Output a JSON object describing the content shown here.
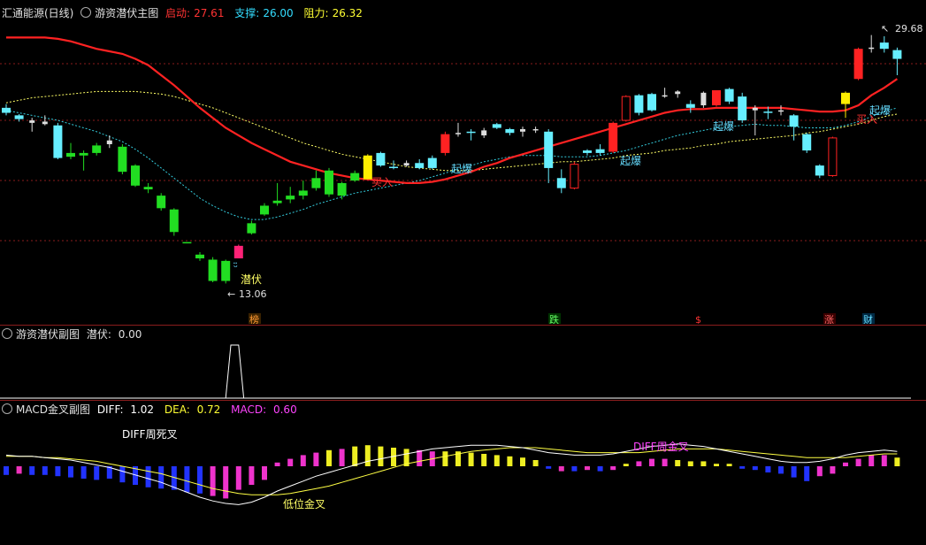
{
  "main_panel": {
    "title": "汇通能源(日线)",
    "indicator_name": "游资潜伏主图",
    "readouts": [
      {
        "label": "启动:",
        "value": "27.61",
        "color": "#ff3333"
      },
      {
        "label": "支撑:",
        "value": "26.00",
        "color": "#33ddff"
      },
      {
        "label": "阻力:",
        "value": "26.32",
        "color": "#ffff33"
      }
    ],
    "high_label": "29.68",
    "low_label": "13.06",
    "annotations": [
      {
        "text": "潜伏",
        "color": "#ffff66"
      },
      {
        "text": "买入",
        "color": "#ff3333"
      },
      {
        "text": "起爆",
        "color": "#66ddff"
      },
      {
        "text": "起爆",
        "color": "#66ddff"
      },
      {
        "text": "起爆",
        "color": "#66ddff"
      },
      {
        "text": "买入",
        "color": "#ff3333"
      },
      {
        "text": "起爆",
        "color": "#66ddff"
      }
    ],
    "markers": [
      {
        "text": "榜",
        "color": "#ff9933"
      },
      {
        "text": "跌",
        "color": "#66ff66"
      },
      {
        "text": "$",
        "color": "#ff3333"
      },
      {
        "text": "涨",
        "color": "#ff6666"
      },
      {
        "text": "财",
        "color": "#66ddff"
      }
    ]
  },
  "sub_panel": {
    "indicator_name": "游资潜伏副图",
    "readout_label": "潜伏:",
    "readout_value": "0.00"
  },
  "macd_panel": {
    "indicator_name": "MACD金叉副图",
    "diff_label": "DIFF:",
    "diff_value": "1.02",
    "dea_label": "DEA:",
    "dea_value": "0.72",
    "macd_label": "MACD:",
    "macd_value": "0.60",
    "annotations": [
      {
        "text": "DIFF周死叉",
        "color": "#ffffff"
      },
      {
        "text": "低位金叉",
        "color": "#ffff66"
      },
      {
        "text": "DIFF周金叉",
        "color": "#ff44ff"
      }
    ]
  },
  "colors": {
    "up": "#66eeff",
    "down": "#22dd22",
    "red_candle": "#ff2222",
    "ma_red": "#ff2222",
    "ma_yellow": "#ffff66",
    "ma_cyan": "#33ccdd",
    "grid": "#8a1d1d"
  },
  "chart_data": {
    "type": "candlestick",
    "candles": [
      {
        "o": 24.2,
        "c": 24.6,
        "h": 24.9,
        "l": 24.0,
        "color": "cyan"
      },
      {
        "o": 24.0,
        "c": 23.7,
        "h": 24.1,
        "l": 23.5,
        "color": "cyan"
      },
      {
        "o": 23.6,
        "c": 23.4,
        "h": 23.8,
        "l": 22.7,
        "color": "white"
      },
      {
        "o": 23.5,
        "c": 23.3,
        "h": 24.0,
        "l": 23.2,
        "color": "white"
      },
      {
        "o": 23.2,
        "c": 20.6,
        "h": 23.4,
        "l": 20.5,
        "color": "cyan"
      },
      {
        "o": 21.0,
        "c": 20.7,
        "h": 21.8,
        "l": 20.5,
        "color": "green"
      },
      {
        "o": 21.0,
        "c": 20.8,
        "h": 21.2,
        "l": 19.6,
        "color": "green"
      },
      {
        "o": 21.0,
        "c": 21.6,
        "h": 21.8,
        "l": 20.8,
        "color": "green"
      },
      {
        "o": 22.0,
        "c": 21.7,
        "h": 22.4,
        "l": 21.4,
        "color": "white"
      },
      {
        "o": 21.5,
        "c": 19.5,
        "h": 21.7,
        "l": 19.3,
        "color": "green"
      },
      {
        "o": 20.0,
        "c": 18.4,
        "h": 20.1,
        "l": 18.3,
        "color": "green"
      },
      {
        "o": 18.3,
        "c": 18.1,
        "h": 18.6,
        "l": 17.8,
        "color": "green"
      },
      {
        "o": 17.6,
        "c": 16.6,
        "h": 17.8,
        "l": 16.4,
        "color": "green"
      },
      {
        "o": 16.5,
        "c": 14.7,
        "h": 16.6,
        "l": 14.4,
        "color": "green"
      },
      {
        "o": 13.9,
        "c": 13.9,
        "h": 13.9,
        "l": 13.9,
        "color": "green"
      },
      {
        "o": 12.9,
        "c": 12.6,
        "h": 13.1,
        "l": 12.4,
        "color": "green"
      },
      {
        "o": 12.5,
        "c": 10.8,
        "h": 12.7,
        "l": 10.7,
        "color": "green"
      },
      {
        "o": 12.4,
        "c": 10.8,
        "h": 12.5,
        "l": 10.6,
        "color": "green"
      },
      {
        "o": 12.6,
        "c": 13.6,
        "h": 13.7,
        "l": 12.6,
        "color": "pink"
      },
      {
        "o": 14.6,
        "c": 15.4,
        "h": 15.6,
        "l": 14.5,
        "color": "green"
      },
      {
        "o": 16.1,
        "c": 16.8,
        "h": 17.0,
        "l": 16.0,
        "color": "green"
      },
      {
        "o": 17.0,
        "c": 17.2,
        "h": 18.6,
        "l": 16.8,
        "color": "green"
      },
      {
        "o": 17.3,
        "c": 17.6,
        "h": 18.3,
        "l": 17.0,
        "color": "green"
      },
      {
        "o": 17.6,
        "c": 18.0,
        "h": 18.8,
        "l": 17.3,
        "color": "green"
      },
      {
        "o": 18.2,
        "c": 19.0,
        "h": 19.6,
        "l": 18.0,
        "color": "green"
      },
      {
        "o": 19.6,
        "c": 17.7,
        "h": 19.8,
        "l": 17.5,
        "color": "green"
      },
      {
        "o": 17.6,
        "c": 18.6,
        "h": 18.7,
        "l": 17.3,
        "color": "green"
      },
      {
        "o": 18.8,
        "c": 19.4,
        "h": 19.6,
        "l": 18.7,
        "color": "green"
      },
      {
        "o": 18.9,
        "c": 20.8,
        "h": 20.9,
        "l": 18.9,
        "color": "yellow"
      },
      {
        "o": 21.0,
        "c": 20.0,
        "h": 21.1,
        "l": 19.9,
        "color": "cyan"
      },
      {
        "o": 19.9,
        "c": 19.9,
        "h": 20.4,
        "l": 19.7,
        "color": "cyan"
      },
      {
        "o": 20.0,
        "c": 20.2,
        "h": 20.4,
        "l": 19.9,
        "color": "white"
      },
      {
        "o": 20.2,
        "c": 19.8,
        "h": 20.5,
        "l": 19.7,
        "color": "cyan"
      },
      {
        "o": 19.8,
        "c": 20.6,
        "h": 20.8,
        "l": 19.7,
        "color": "cyan"
      },
      {
        "o": 21.0,
        "c": 22.5,
        "h": 22.7,
        "l": 20.8,
        "color": "red"
      },
      {
        "o": 22.6,
        "c": 22.6,
        "h": 23.4,
        "l": 22.3,
        "color": "white"
      },
      {
        "o": 22.6,
        "c": 22.7,
        "h": 22.9,
        "l": 22.0,
        "color": "cyan"
      },
      {
        "o": 22.8,
        "c": 22.4,
        "h": 23.0,
        "l": 22.2,
        "color": "white"
      },
      {
        "o": 23.0,
        "c": 23.3,
        "h": 23.4,
        "l": 22.9,
        "color": "cyan"
      },
      {
        "o": 22.9,
        "c": 22.6,
        "h": 23.0,
        "l": 22.4,
        "color": "cyan"
      },
      {
        "o": 22.7,
        "c": 22.9,
        "h": 23.1,
        "l": 22.3,
        "color": "white"
      },
      {
        "o": 22.9,
        "c": 22.8,
        "h": 23.1,
        "l": 22.6,
        "color": "white"
      },
      {
        "o": 22.7,
        "c": 19.8,
        "h": 22.9,
        "l": 18.6,
        "color": "cyan"
      },
      {
        "o": 19.0,
        "c": 18.2,
        "h": 19.7,
        "l": 17.8,
        "color": "cyan"
      },
      {
        "o": 18.2,
        "c": 20.1,
        "h": 20.3,
        "l": 18.1,
        "color": "hollow"
      },
      {
        "o": 21.2,
        "c": 21.0,
        "h": 21.3,
        "l": 20.8,
        "color": "cyan"
      },
      {
        "o": 21.3,
        "c": 21.0,
        "h": 21.7,
        "l": 20.8,
        "color": "cyan"
      },
      {
        "o": 21.1,
        "c": 23.4,
        "h": 23.5,
        "l": 21.0,
        "color": "red"
      },
      {
        "o": 23.6,
        "c": 25.5,
        "h": 25.6,
        "l": 23.5,
        "color": "hollow"
      },
      {
        "o": 25.6,
        "c": 24.2,
        "h": 25.7,
        "l": 24.0,
        "color": "cyan"
      },
      {
        "o": 24.4,
        "c": 25.7,
        "h": 25.8,
        "l": 24.3,
        "color": "cyan"
      },
      {
        "o": 25.6,
        "c": 25.6,
        "h": 26.2,
        "l": 25.4,
        "color": "white"
      },
      {
        "o": 25.7,
        "c": 25.9,
        "h": 26.0,
        "l": 25.4,
        "color": "white"
      },
      {
        "o": 24.9,
        "c": 24.6,
        "h": 25.2,
        "l": 24.2,
        "color": "cyan"
      },
      {
        "o": 24.8,
        "c": 25.8,
        "h": 25.9,
        "l": 24.6,
        "color": "white"
      },
      {
        "o": 24.8,
        "c": 26.0,
        "h": 26.0,
        "l": 24.7,
        "color": "red"
      },
      {
        "o": 26.1,
        "c": 25.1,
        "h": 26.2,
        "l": 24.9,
        "color": "cyan"
      },
      {
        "o": 25.5,
        "c": 23.6,
        "h": 25.8,
        "l": 23.4,
        "color": "cyan"
      },
      {
        "o": 24.4,
        "c": 24.6,
        "h": 24.8,
        "l": 22.4,
        "color": "white"
      },
      {
        "o": 24.2,
        "c": 24.3,
        "h": 24.7,
        "l": 23.7,
        "color": "cyan"
      },
      {
        "o": 24.4,
        "c": 24.3,
        "h": 24.8,
        "l": 24.0,
        "color": "white"
      },
      {
        "o": 24.0,
        "c": 23.1,
        "h": 24.1,
        "l": 22.0,
        "color": "cyan"
      },
      {
        "o": 22.5,
        "c": 21.2,
        "h": 22.6,
        "l": 21.0,
        "color": "cyan"
      },
      {
        "o": 20.0,
        "c": 19.2,
        "h": 20.1,
        "l": 19.0,
        "color": "cyan"
      },
      {
        "o": 19.2,
        "c": 22.2,
        "h": 22.3,
        "l": 19.1,
        "color": "hollow"
      },
      {
        "o": 24.9,
        "c": 25.8,
        "h": 25.9,
        "l": 23.8,
        "color": "yellow"
      },
      {
        "o": 26.9,
        "c": 29.3,
        "h": 29.4,
        "l": 26.8,
        "color": "red"
      },
      {
        "o": 29.4,
        "c": 29.4,
        "h": 30.4,
        "l": 29.0,
        "color": "white"
      },
      {
        "o": 29.8,
        "c": 29.3,
        "h": 30.3,
        "l": 29.0,
        "color": "cyan"
      },
      {
        "o": 29.2,
        "c": 28.5,
        "h": 29.4,
        "l": 27.2,
        "color": "cyan"
      }
    ],
    "ma_red": [
      30.2,
      30.2,
      30.2,
      30.2,
      30.1,
      29.9,
      29.6,
      29.3,
      29.1,
      28.9,
      28.5,
      28.0,
      27.2,
      26.4,
      25.5,
      24.6,
      23.8,
      23.0,
      22.4,
      21.8,
      21.3,
      20.8,
      20.3,
      20.0,
      19.7,
      19.4,
      19.2,
      19.0,
      18.9,
      18.8,
      18.7,
      18.6,
      18.6,
      18.7,
      18.9,
      19.2,
      19.5,
      19.9,
      20.2,
      20.6,
      20.9,
      21.2,
      21.5,
      21.8,
      22.1,
      22.4,
      22.7,
      23.0,
      23.3,
      23.6,
      23.9,
      24.2,
      24.4,
      24.5,
      24.5,
      24.6,
      24.6,
      24.6,
      24.6,
      24.6,
      24.6,
      24.5,
      24.4,
      24.3,
      24.3,
      24.4,
      24.8,
      25.6,
      26.2,
      26.9
    ],
    "ma_yellow": [
      25.0,
      25.2,
      25.4,
      25.5,
      25.6,
      25.7,
      25.8,
      25.9,
      25.9,
      25.9,
      25.9,
      25.8,
      25.7,
      25.5,
      25.2,
      24.9,
      24.6,
      24.2,
      23.8,
      23.4,
      23.0,
      22.6,
      22.2,
      21.8,
      21.5,
      21.2,
      20.9,
      20.7,
      20.5,
      20.3,
      20.1,
      19.9,
      19.8,
      19.7,
      19.6,
      19.6,
      19.6,
      19.7,
      19.8,
      19.9,
      20.0,
      20.1,
      20.2,
      20.3,
      20.3,
      20.4,
      20.5,
      20.6,
      20.8,
      20.9,
      21.0,
      21.2,
      21.3,
      21.4,
      21.6,
      21.7,
      21.9,
      22.0,
      22.1,
      22.2,
      22.3,
      22.4,
      22.6,
      22.7,
      22.9,
      23.1,
      23.3,
      23.6,
      23.9,
      24.1
    ],
    "ma_cyan": [
      24.4,
      24.2,
      24.0,
      23.8,
      23.6,
      23.3,
      23.0,
      22.7,
      22.3,
      21.9,
      21.3,
      20.6,
      19.8,
      19.0,
      18.2,
      17.4,
      16.8,
      16.3,
      15.9,
      15.7,
      15.7,
      15.9,
      16.2,
      16.5,
      16.9,
      17.2,
      17.5,
      17.8,
      18.0,
      18.2,
      18.4,
      18.6,
      18.8,
      19.1,
      19.4,
      19.7,
      20.0,
      20.3,
      20.5,
      20.7,
      20.8,
      20.8,
      20.8,
      20.7,
      20.7,
      20.7,
      20.8,
      21.0,
      21.2,
      21.5,
      21.8,
      22.1,
      22.4,
      22.6,
      22.8,
      23.0,
      23.1,
      23.2,
      23.3,
      23.2,
      23.2,
      23.1,
      23.0,
      23.0,
      23.0,
      23.2,
      23.5,
      23.9,
      24.3,
      24.6
    ],
    "latent_x": [
      0,
      17,
      17.4,
      18,
      18.4,
      69
    ],
    "latent_y": [
      0,
      0,
      1,
      1,
      0,
      0
    ],
    "macd_hist": [
      -0.7,
      -0.6,
      -0.7,
      -0.7,
      -0.8,
      -0.9,
      -1.0,
      -1.1,
      -1.0,
      -1.3,
      -1.5,
      -1.7,
      -1.8,
      -1.9,
      -2.1,
      -2.2,
      -2.4,
      -2.6,
      -1.9,
      -1.5,
      -1.1,
      0.3,
      0.6,
      0.9,
      1.1,
      1.3,
      1.4,
      1.6,
      1.7,
      1.6,
      1.5,
      1.4,
      1.3,
      1.2,
      1.2,
      1.2,
      1.1,
      1.0,
      0.9,
      0.8,
      0.7,
      0.5,
      -0.2,
      -0.4,
      -0.4,
      -0.3,
      -0.4,
      -0.3,
      0.2,
      0.4,
      0.6,
      0.6,
      0.5,
      0.4,
      0.4,
      0.2,
      0.2,
      -0.2,
      -0.3,
      -0.5,
      -0.6,
      -0.9,
      -1.2,
      -0.8,
      -0.6,
      0.3,
      0.6,
      0.9,
      0.9,
      0.7
    ],
    "macd_hist_color": [
      "blue",
      "pink",
      "blue",
      "blue",
      "blue",
      "blue",
      "blue",
      "blue",
      "blue",
      "blue",
      "blue",
      "blue",
      "blue",
      "blue",
      "blue",
      "blue",
      "magenta",
      "magenta",
      "magenta",
      "magenta",
      "magenta",
      "magenta",
      "magenta",
      "magenta",
      "magenta",
      "yellow",
      "magenta",
      "yellow",
      "yellow",
      "yellow",
      "yellow",
      "yellow",
      "magenta",
      "magenta",
      "yellow",
      "yellow",
      "yellow",
      "yellow",
      "yellow",
      "yellow",
      "yellow",
      "yellow",
      "blue",
      "pink",
      "blue",
      "pink",
      "blue",
      "magenta",
      "yellow",
      "magenta",
      "magenta",
      "magenta",
      "yellow",
      "yellow",
      "yellow",
      "yellow",
      "yellow",
      "blue",
      "blue",
      "blue",
      "blue",
      "blue",
      "blue",
      "magenta",
      "magenta",
      "magenta",
      "magenta",
      "magenta",
      "magenta",
      "yellow"
    ],
    "diff": [
      0.9,
      0.8,
      0.8,
      0.7,
      0.6,
      0.5,
      0.3,
      0.1,
      -0.1,
      -0.4,
      -0.7,
      -1.0,
      -1.3,
      -1.7,
      -2.1,
      -2.5,
      -2.8,
      -3.0,
      -3.1,
      -2.9,
      -2.5,
      -2.0,
      -1.6,
      -1.2,
      -0.8,
      -0.5,
      -0.2,
      0.1,
      0.4,
      0.6,
      0.8,
      1.0,
      1.2,
      1.4,
      1.5,
      1.6,
      1.7,
      1.7,
      1.7,
      1.6,
      1.5,
      1.3,
      1.1,
      1.0,
      0.9,
      0.9,
      0.9,
      1.0,
      1.2,
      1.4,
      1.6,
      1.7,
      1.8,
      1.7,
      1.6,
      1.4,
      1.2,
      1.0,
      0.8,
      0.6,
      0.4,
      0.3,
      0.3,
      0.4,
      0.6,
      0.9,
      1.1,
      1.2,
      1.3,
      1.2
    ],
    "dea": [
      0.8,
      0.8,
      0.8,
      0.7,
      0.7,
      0.6,
      0.5,
      0.4,
      0.2,
      0.0,
      -0.2,
      -0.4,
      -0.6,
      -0.9,
      -1.2,
      -1.5,
      -1.8,
      -2.0,
      -2.2,
      -2.3,
      -2.3,
      -2.3,
      -2.2,
      -2.0,
      -1.8,
      -1.6,
      -1.3,
      -1.0,
      -0.7,
      -0.4,
      -0.1,
      0.2,
      0.4,
      0.6,
      0.8,
      1.0,
      1.2,
      1.3,
      1.4,
      1.5,
      1.5,
      1.5,
      1.4,
      1.3,
      1.2,
      1.1,
      1.1,
      1.1,
      1.1,
      1.1,
      1.2,
      1.3,
      1.4,
      1.4,
      1.4,
      1.4,
      1.3,
      1.2,
      1.1,
      1.0,
      0.9,
      0.8,
      0.7,
      0.7,
      0.7,
      0.7,
      0.8,
      0.9,
      1.0,
      1.0
    ]
  }
}
